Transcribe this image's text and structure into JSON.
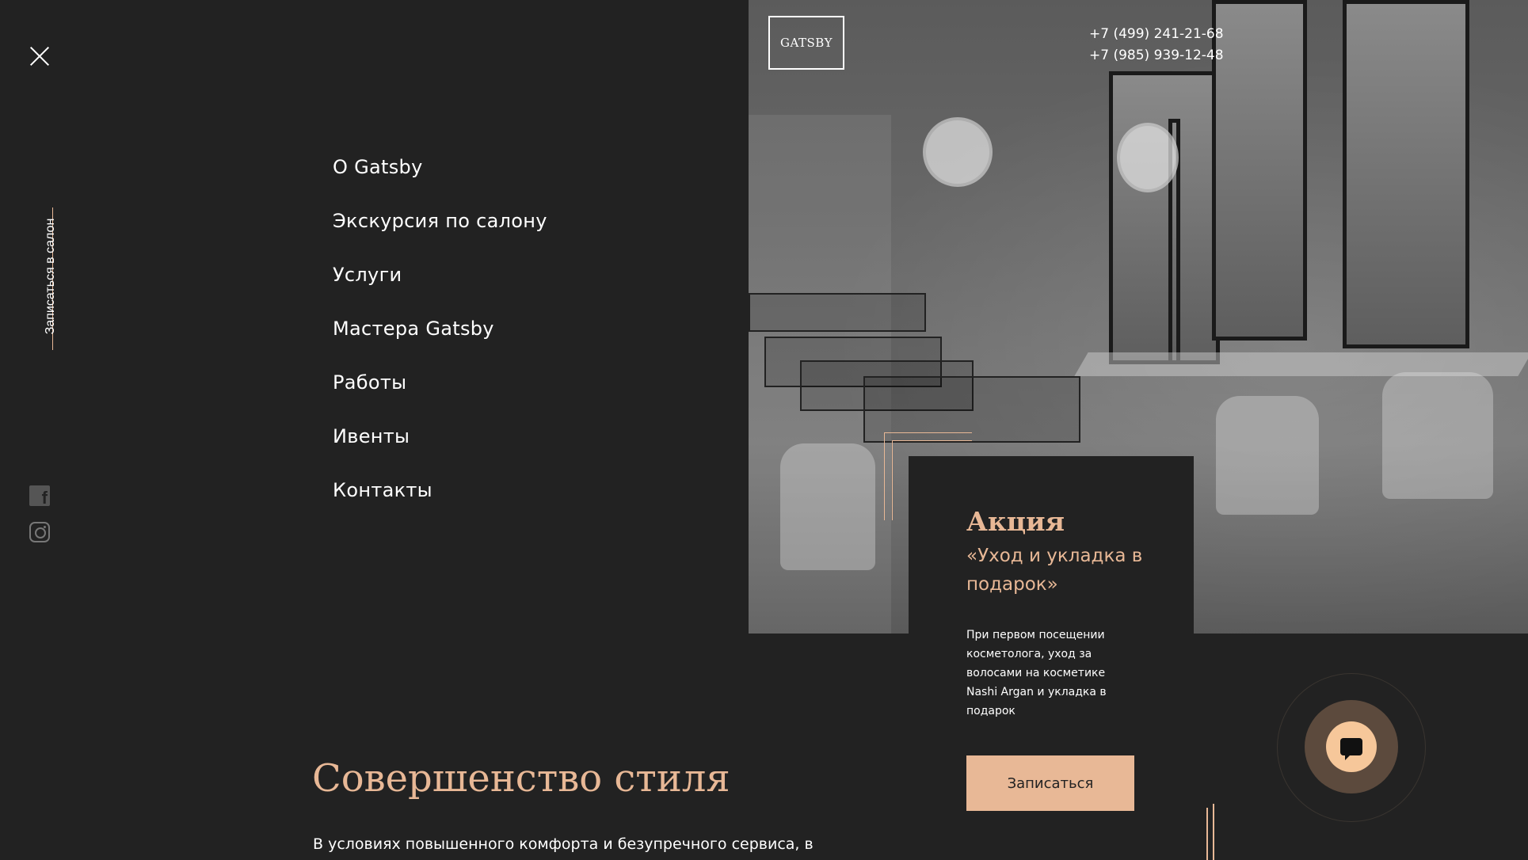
{
  "menu": {
    "side_booking": "Записаться в салон",
    "items": [
      {
        "label": "О Gatsby"
      },
      {
        "label": "Экскурсия по салону"
      },
      {
        "label": "Услуги"
      },
      {
        "label": "Мастера Gatsby"
      },
      {
        "label": "Работы"
      },
      {
        "label": "Ивенты"
      },
      {
        "label": "Контакты"
      }
    ],
    "social": [
      "facebook-icon",
      "instagram-icon"
    ]
  },
  "header": {
    "logo": "GATSBY",
    "phones": [
      "+7 (499) 241-21-68",
      "+7 (985) 939-12-48"
    ]
  },
  "promo": {
    "title": "Акция",
    "subtitle": "«Уход и укладка в подарок»",
    "description": "При первом посещении косметолога, уход за волосами на косметике Nashi Argan и укладка в подарок",
    "button": "Записаться"
  },
  "section": {
    "title": "Совершенство стиля",
    "text": "В условиях повышенного комфорта и безупречного сервиса, в"
  },
  "colors": {
    "background": "#222222",
    "accent": "#e8b896",
    "chat_accent": "#f6c79a"
  }
}
